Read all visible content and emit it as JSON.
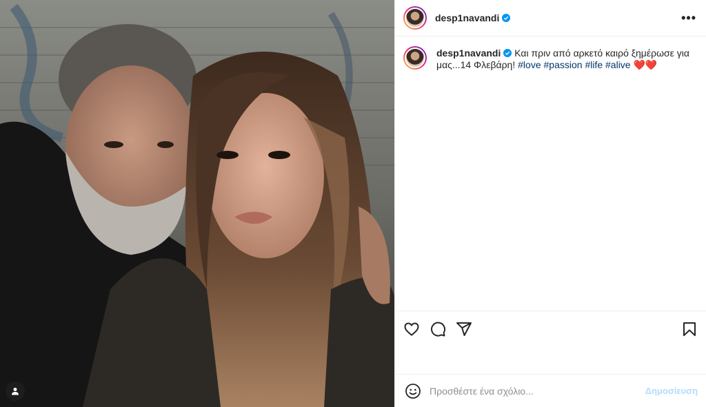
{
  "post": {
    "username": "desp1navandi",
    "verified": true,
    "caption": {
      "text_before": "Και πριν από αρκετό καιρό ξημέρωσε για μας...14 Φλεβάρη!",
      "hashtags": [
        "#love",
        "#passion",
        "#life",
        "#alive"
      ],
      "emoji": "❤️❤️"
    },
    "more_menu": "•••",
    "comment": {
      "placeholder": "Προσθέστε ένα σχόλιο...",
      "post_label": "Δημοσίευση"
    },
    "photo": {
      "description_icon": "user-tag-icon"
    }
  },
  "colors": {
    "accent": "#0095f6",
    "hashtag": "#00376b",
    "border": "#efefef",
    "text": "#262626"
  }
}
